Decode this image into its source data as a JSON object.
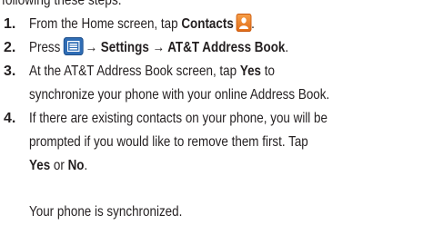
{
  "intro": "following these steps:",
  "steps": [
    {
      "number": "1.",
      "parts": {
        "a": "From the Home screen, tap ",
        "b": "Contacts",
        "c": "."
      },
      "icon": "contacts-app-icon"
    },
    {
      "number": "2.",
      "parts": {
        "a": "Press ",
        "b": "→ Settings → AT&T Address Book",
        "c": "."
      },
      "icon": "menu-key-icon"
    },
    {
      "number": "3.",
      "line1": {
        "a": "At the AT&T Address Book screen, tap ",
        "b": "Yes",
        "c": " to"
      },
      "line2": "synchronize your phone with your online Address Book."
    },
    {
      "number": "4.",
      "line1": "If there are existing contacts on your phone, you will be",
      "line2": "prompted if you would like to remove them first. Tap",
      "line3": {
        "a": "Yes",
        "b": " or ",
        "c": "No",
        "d": "."
      }
    }
  ],
  "result": "Your phone is synchronized."
}
